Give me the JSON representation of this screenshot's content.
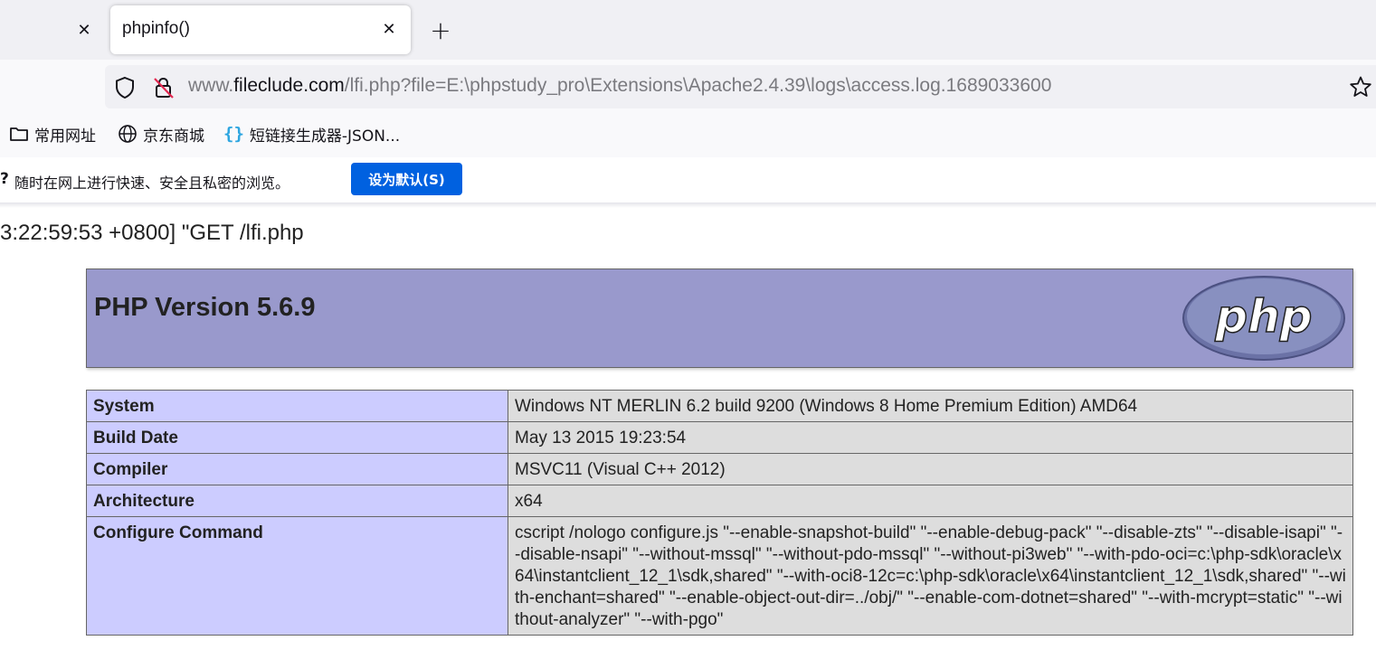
{
  "browser": {
    "tab_title": "phpinfo()",
    "url_prefix": "www.",
    "url_domain": "fileclude.com",
    "url_path": "/lfi.php?file=E:\\phpstudy_pro\\Extensions\\Apache2.4.39\\logs\\access.log.1689033600",
    "bookmarks": [
      {
        "label": "常用网址",
        "icon": "folder-icon"
      },
      {
        "label": "京东商城",
        "icon": "globe-icon"
      },
      {
        "label": "短链接生成器-JSON...",
        "icon": "json-brace-icon"
      }
    ],
    "notification": {
      "prefix": "?",
      "text": "随时在网上进行快速、安全且私密的浏览。",
      "button": "设为默认(S)",
      "button_color": "#0061e0"
    }
  },
  "page": {
    "log_line": "3:22:59:53 +0800] \"GET /lfi.php",
    "php_version_title": "PHP Version 5.6.9",
    "logo_text": "php",
    "header_color": "#9999cc",
    "rows": [
      {
        "key": "System",
        "value": "Windows NT MERLIN 6.2 build 9200 (Windows 8 Home Premium Edition) AMD64"
      },
      {
        "key": "Build Date",
        "value": "May 13 2015 19:23:54"
      },
      {
        "key": "Compiler",
        "value": "MSVC11 (Visual C++ 2012)"
      },
      {
        "key": "Architecture",
        "value": "x64"
      },
      {
        "key": "Configure Command",
        "value": "cscript /nologo configure.js \"--enable-snapshot-build\" \"--enable-debug-pack\" \"--disable-zts\" \"--disable-isapi\" \"--disable-nsapi\" \"--without-mssql\" \"--without-pdo-mssql\" \"--without-pi3web\" \"--with-pdo-oci=c:\\php-sdk\\oracle\\x64\\instantclient_12_1\\sdk,shared\" \"--with-oci8-12c=c:\\php-sdk\\oracle\\x64\\instantclient_12_1\\sdk,shared\" \"--with-enchant=shared\" \"--enable-object-out-dir=../obj/\" \"--enable-com-dotnet=shared\" \"--with-mcrypt=static\" \"--without-analyzer\" \"--with-pgo\""
      }
    ]
  }
}
